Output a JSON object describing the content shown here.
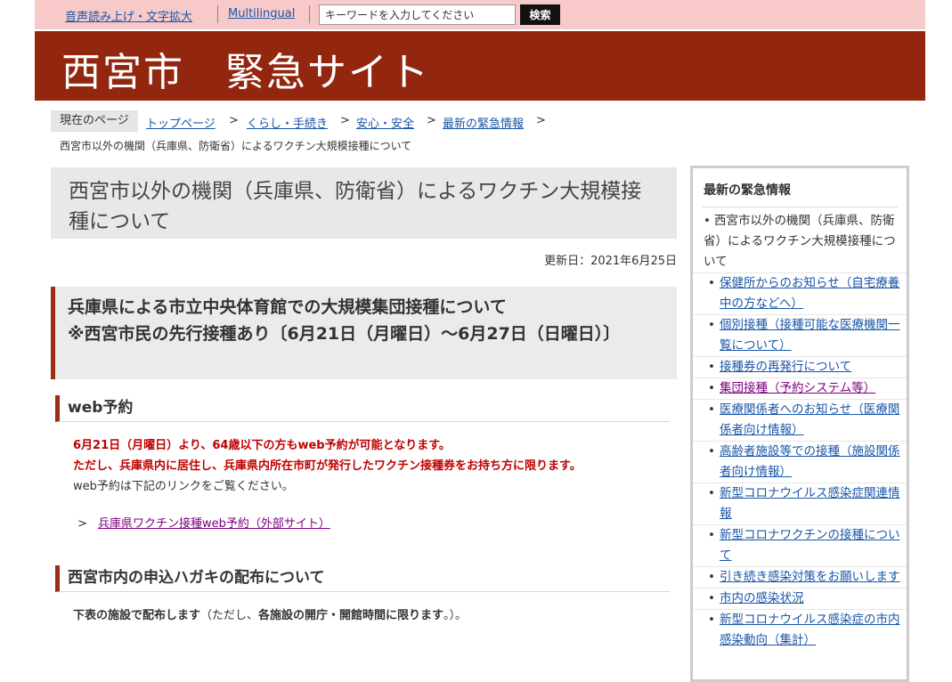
{
  "utility": {
    "read_aloud_label": "音声読み上げ・文字拡大",
    "multilingual_label": "Multilingual",
    "search_placeholder": "キーワードを入力してください",
    "search_button_label": "検索"
  },
  "header": {
    "site_title": "西宮市　緊急サイト"
  },
  "breadcrumb": {
    "label": "現在のページ",
    "items": [
      "トップページ",
      "くらし・手続き",
      "安心・安全",
      "最新の緊急情報"
    ],
    "separator": ">",
    "current": "西宮市以外の機関（兵庫県、防衛省）によるワクチン大規模接種について"
  },
  "page": {
    "title": "西宮市以外の機関（兵庫県、防衛省）によるワクチン大規模接種について",
    "updated": "更新日：2021年6月25日"
  },
  "section": {
    "h2_line1": "兵庫県による市立中央体育館での大規模集団接種について",
    "h2_line2": "※西宮市民の先行接種あり〔6月21日（月曜日）～6月27日（日曜日）〕",
    "web": {
      "heading": "web予約",
      "notice_1": "6月21日（月曜日）より、64歳以下の方もweb予約が可能となります。",
      "notice_2": "ただし、兵庫県内に居住し、兵庫県内所在市町が発行したワクチン接種券をお持ち方に限ります。",
      "body": "web予約は下記のリンクをご覧ください。",
      "link_marker": ">",
      "link_label": "兵庫県ワクチン接種web予約（外部サイト）"
    },
    "postcard": {
      "heading": "西宮市内の申込ハガキの配布について",
      "text_bold": "下表の施設で配布します",
      "text_paren_open": "（ただし、",
      "text_bold_2": "各施設の開庁・開館時間に限ります",
      "text_end": "。）。"
    }
  },
  "sidebar": {
    "title": "最新の緊急情報",
    "current_item": "西宮市以外の機関（兵庫県、防衛省）によるワクチン大規模接種について",
    "items": [
      {
        "label": "保健所からのお知らせ（自宅療養中の方などへ）",
        "visited": false
      },
      {
        "label": "個別接種（接種可能な医療機関一覧について）",
        "visited": false
      },
      {
        "label": "接種券の再発行について",
        "visited": false
      },
      {
        "label": "集団接種（予約システム等）",
        "visited": true
      },
      {
        "label": "医療関係者へのお知らせ（医療関係者向け情報）",
        "visited": false
      },
      {
        "label": "高齢者施設等での接種（施設関係者向け情報）",
        "visited": false
      },
      {
        "label": "新型コロナウイルス感染症関連情報",
        "visited": false
      },
      {
        "label": "新型コロナワクチンの接種について",
        "visited": false
      },
      {
        "label": "引き続き感染対策をお願いします",
        "visited": false
      },
      {
        "label": "市内の感染状況",
        "visited": false
      },
      {
        "label": "新型コロナウイルス感染症の市内感染動向（集計）",
        "visited": false
      }
    ]
  },
  "colors": {
    "header_bg": "#93260f",
    "topbar_bg": "#f8c9c9",
    "accent_border": "#9c2d13",
    "notice_text": "#c00000",
    "link": "#1a56a8",
    "visited_link": "#800080"
  }
}
